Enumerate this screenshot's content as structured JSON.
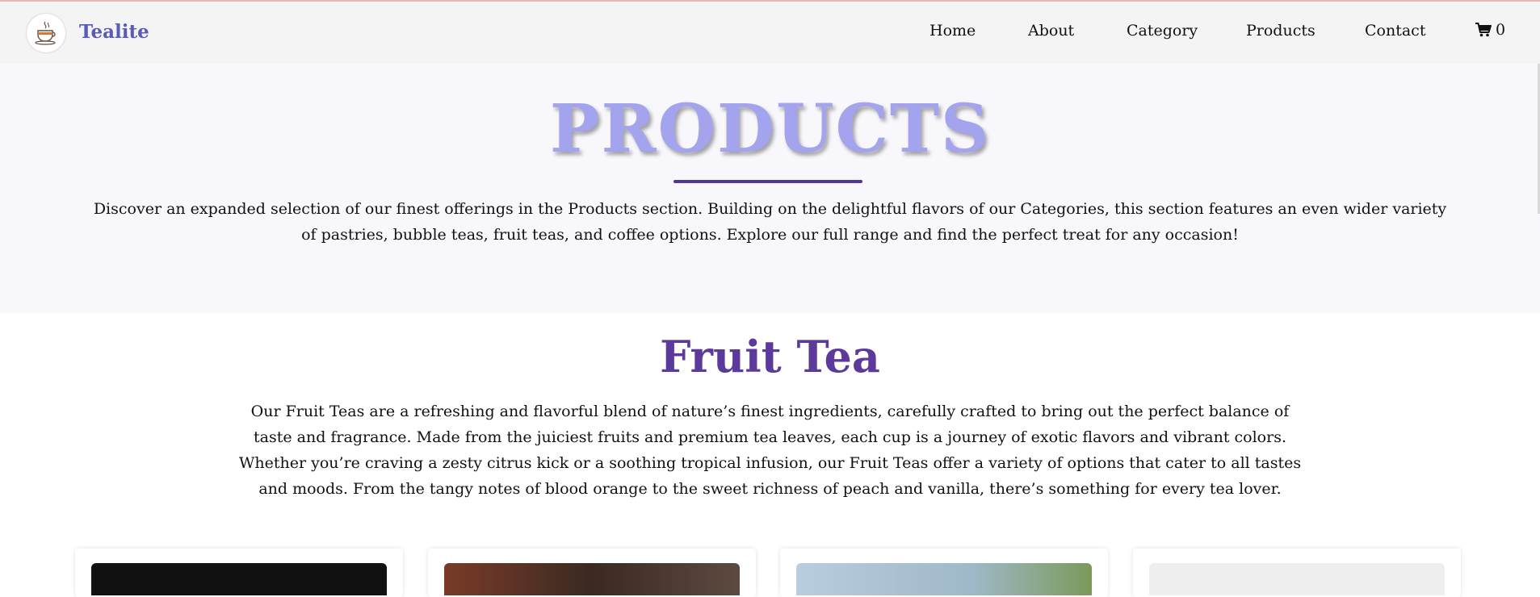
{
  "brand": {
    "name": "Tealite",
    "logo_icon": "teacup-icon"
  },
  "nav": {
    "items": [
      {
        "label": "Home"
      },
      {
        "label": "About"
      },
      {
        "label": "Category"
      },
      {
        "label": "Products"
      },
      {
        "label": "Contact"
      }
    ],
    "cart": {
      "icon": "cart-icon",
      "count": "0"
    }
  },
  "hero": {
    "title": "PRODUCTS",
    "description": "Discover an expanded selection of our finest offerings in the Products section. Building on the delightful flavors of our Categories, this section features an even wider variety of pastries, bubble teas, fruit teas, and coffee options. Explore our full range and find the perfect treat for any occasion!"
  },
  "section": {
    "title": "Fruit Tea",
    "description": "Our Fruit Teas are a refreshing and flavorful blend of nature’s finest ingredients, carefully crafted to bring out the perfect balance of taste and fragrance. Made from the juiciest fruits and premium tea leaves, each cup is a journey of exotic flavors and vibrant colors. Whether you’re craving a zesty citrus kick or a soothing tropical infusion, our Fruit Teas offer a variety of options that cater to all tastes and moods. From the tangy notes of blood orange to the sweet richness of peach and vanilla, there’s something for every tea lover."
  },
  "colors": {
    "brand": "#5a5ab8",
    "hero_title": "#a3a3ee",
    "accent": "#52379a",
    "section_title": "#5c3a9c"
  }
}
